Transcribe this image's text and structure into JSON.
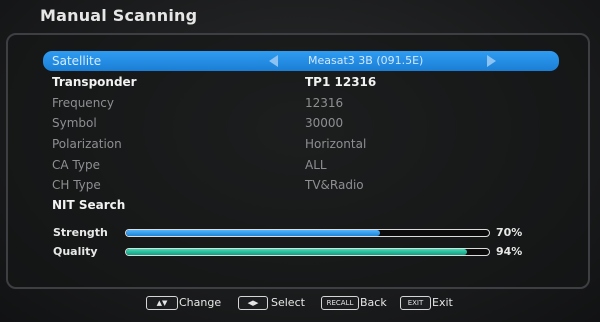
{
  "title": "Manual Scanning",
  "rows": [
    {
      "label": "Satellite",
      "value": "Measat3 3B (091.5E)"
    },
    {
      "label": "Transponder",
      "value": "TP1  12316"
    },
    {
      "label": "Frequency",
      "value": "12316"
    },
    {
      "label": "Symbol",
      "value": "30000"
    },
    {
      "label": "Polarization",
      "value": "Horizontal"
    },
    {
      "label": "CA Type",
      "value": "ALL"
    },
    {
      "label": "CH Type",
      "value": "TV&Radio"
    },
    {
      "label": "NIT Search",
      "value": ""
    }
  ],
  "signal": {
    "strength": {
      "label": "Strength",
      "percent_text": "70%",
      "level": 0.7
    },
    "quality": {
      "label": "Quality",
      "percent_text": "94%",
      "level": 0.94
    }
  },
  "footer": {
    "change_key": "▲▼",
    "change_label": "Change",
    "select_key": "◀▶",
    "select_label": "Select",
    "back_key": "RECALL",
    "back_label": "Back",
    "exit_key": "EXIT",
    "exit_label": "Exit"
  },
  "colors": {
    "selection": "#2f9cf1",
    "strength_bar": "#3a9fef",
    "quality_bar": "#2cc6a2"
  }
}
